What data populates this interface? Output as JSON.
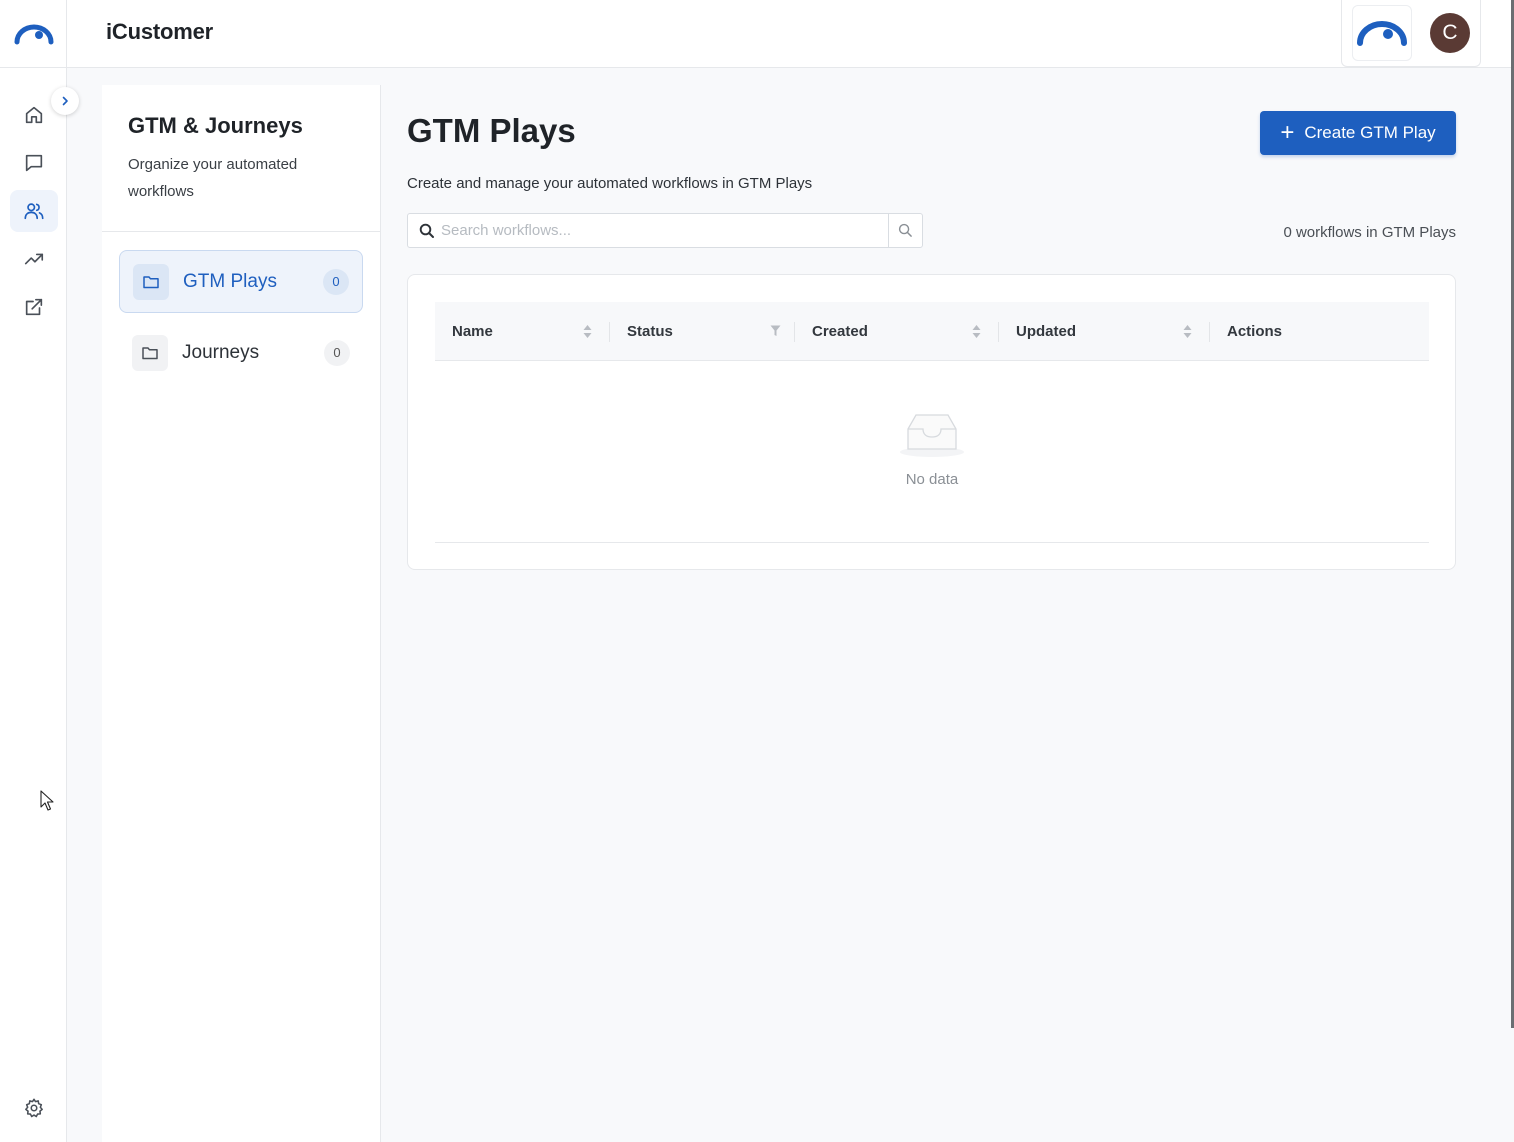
{
  "app": {
    "title": "iCustomer",
    "accent": "#1e5fbf"
  },
  "rail": {
    "items": [
      {
        "name": "home",
        "icon": "home-icon"
      },
      {
        "name": "messages",
        "icon": "chat-icon"
      },
      {
        "name": "people",
        "icon": "users-icon",
        "active": true
      },
      {
        "name": "analytics",
        "icon": "trending-up-icon"
      },
      {
        "name": "external",
        "icon": "external-link-icon"
      }
    ],
    "settings_icon": "gear-icon"
  },
  "header": {
    "avatar_initial": "C"
  },
  "subnav": {
    "title": "GTM & Journeys",
    "description": "Organize your automated workflows",
    "items": [
      {
        "label": "GTM Plays",
        "count": "0",
        "active": true
      },
      {
        "label": "Journeys",
        "count": "0",
        "active": false
      }
    ]
  },
  "main": {
    "title": "GTM Plays",
    "description": "Create and manage your automated workflows in GTM Plays",
    "create_label": "Create GTM Play",
    "search_placeholder": "Search workflows...",
    "count_text": "0 workflows in GTM Plays",
    "table": {
      "columns": [
        "Name",
        "Status",
        "Created",
        "Updated",
        "Actions"
      ],
      "empty_text": "No data"
    }
  }
}
